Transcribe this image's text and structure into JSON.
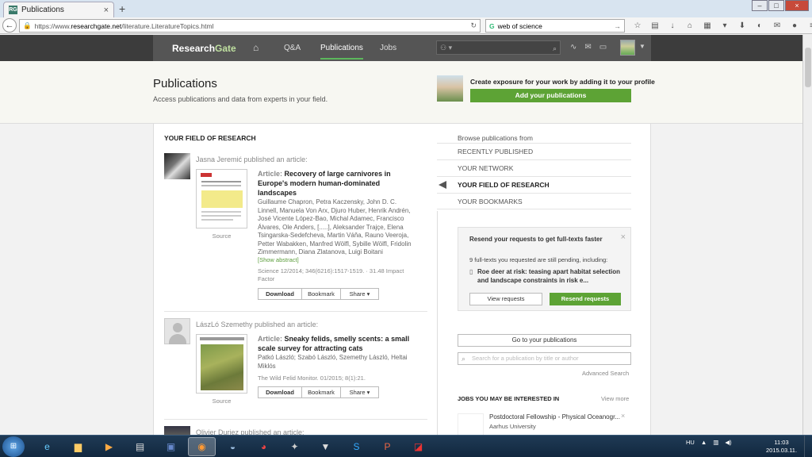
{
  "browser": {
    "tab_title": "Publications",
    "tab_favicon": "RG",
    "new_tab": "+",
    "url_prefix": "https://www.",
    "url_domain": "researchgate.net",
    "url_path": "/literature.LiteratureTopics.html",
    "search_value": "web of science"
  },
  "rg_nav": {
    "logo_main": "Research",
    "logo_accent": "Gate",
    "links": [
      "Q&A",
      "Publications",
      "Jobs"
    ],
    "active": "Publications"
  },
  "header": {
    "title": "Publications",
    "subtitle": "Access publications and data from experts in your field.",
    "cta_text": "Create exposure for your work by adding it to your profile",
    "cta_button": "Add your publications"
  },
  "feed": {
    "section_title": "YOUR FIELD OF RESEARCH",
    "items": [
      {
        "published_by": "Jasna Jeremić published an article:",
        "source": "Source",
        "article_label": "Article:",
        "title": "Recovery of large carnivores in Europe's modern human-dominated landscapes",
        "authors": "Guillaume Chapron, Petra Kaczensky, John D. C. Linnell, Manuela Von Arx, Djuro Huber, Henrik Andrén, José Vicente López-Bao, Michal Adamec, Francisco Álvares, Ole Anders, [.....], Aleksander Trajçe, Elena Tsingarska-Sedefcheva, Martin Váňa, Rauno Veeroja, Petter Wabakken, Manfred Wölfl, Sybille Wölfl, Fridolin Zimmermann, Diana Zlatanova, Luigi Boitani",
        "show_abstract": "[Show abstract]",
        "meta": "Science 12/2014; 346(6216):1517-1519. · 31.48 Impact Factor",
        "download": "Download",
        "bookmark": "Bookmark",
        "share": "Share ▾"
      },
      {
        "published_by": "LászLó Szemethy published an article:",
        "source": "Source",
        "article_label": "Article:",
        "title": "Sneaky felids, smelly scents: a small scale survey for attracting cats",
        "authors": "Patkó László; Szabó László, Szemethy László, Heltai Miklós",
        "meta": "The Wild Felid Monitor. 01/2015; 8(1):21.",
        "download": "Download",
        "bookmark": "Bookmark",
        "share": "Share ▾"
      },
      {
        "published_by": "Olivier Duriez published an article:"
      }
    ]
  },
  "sidebar": {
    "browse_label": "Browse publications from",
    "items": [
      "RECENTLY PUBLISHED",
      "YOUR NETWORK",
      "YOUR FIELD OF RESEARCH",
      "YOUR BOOKMARKS"
    ],
    "selected": "YOUR FIELD OF RESEARCH",
    "resend": {
      "title": "Resend your requests to get full-texts faster",
      "desc": "9 full-texts you requested are still pending, including:",
      "doc": "Roe deer at risk: teasing apart habitat selection and landscape constraints in risk e...",
      "view": "View requests",
      "resend": "Resend requests"
    },
    "goto": "Go to your publications",
    "search_placeholder": "Search for a publication by title or author",
    "advanced": "Advanced Search",
    "jobs_title": "JOBS YOU MAY BE INTERESTED IN",
    "view_more": "View more",
    "job_title": "Postdoctoral Fellowship - Physical Oceanogr...",
    "job_org": "Aarhus University"
  },
  "taskbar": {
    "lang": "HU",
    "time": "11:03",
    "date": "2015.03.11."
  },
  "colors": {
    "accent_green": "#5da335",
    "nav_dark": "#3c3c3c"
  }
}
